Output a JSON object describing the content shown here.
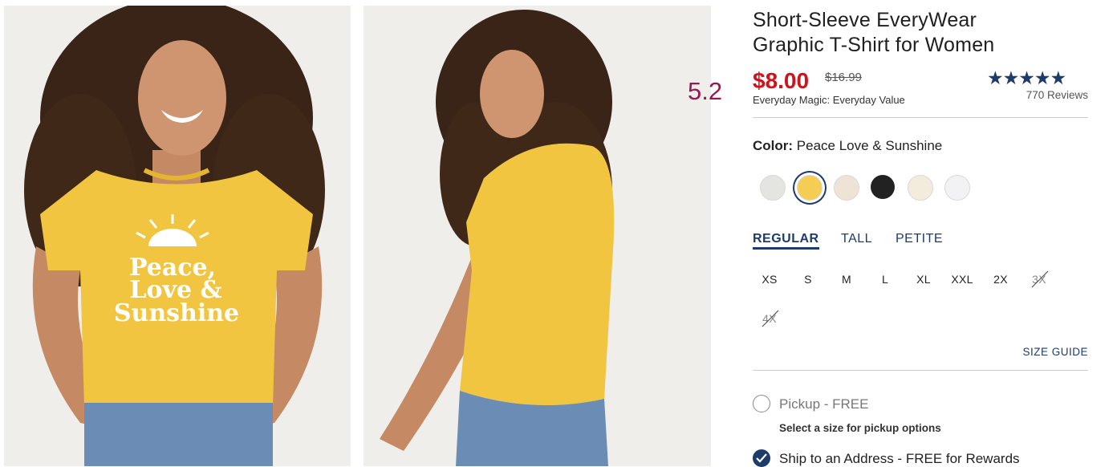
{
  "overlay_label": "5.2",
  "product": {
    "title_line1": "Short-Sleeve EveryWear",
    "title_line2": "Graphic T-Shirt for Women",
    "sale_price": "$8.00",
    "original_price": "$16.99",
    "value_note": "Everyday Magic: Everyday Value",
    "rating": 4.5,
    "stars_display": "★★★★★",
    "reviews": "770 Reviews",
    "shirt_graphic": [
      "Peace,",
      "Love &",
      "Sunshine"
    ]
  },
  "color": {
    "label": "Color:",
    "value": "Peace Love & Sunshine",
    "swatches": [
      {
        "name": "light-gray",
        "hex": "#e4e4e1",
        "selected": false
      },
      {
        "name": "yellow",
        "hex": "#f5cd55",
        "selected": true
      },
      {
        "name": "beige",
        "hex": "#efe3d5",
        "selected": false
      },
      {
        "name": "black",
        "hex": "#222222",
        "selected": false
      },
      {
        "name": "cream",
        "hex": "#f3ecdc",
        "selected": false
      },
      {
        "name": "white",
        "hex": "#f2f2f4",
        "selected": false
      }
    ]
  },
  "fit_tabs": [
    {
      "label": "REGULAR",
      "active": true
    },
    {
      "label": "TALL",
      "active": false
    },
    {
      "label": "PETITE",
      "active": false
    }
  ],
  "sizes": [
    {
      "label": "XS",
      "available": true
    },
    {
      "label": "S",
      "available": true
    },
    {
      "label": "M",
      "available": true
    },
    {
      "label": "L",
      "available": true
    },
    {
      "label": "XL",
      "available": true
    },
    {
      "label": "XXL",
      "available": true
    },
    {
      "label": "2X",
      "available": true
    },
    {
      "label": "3X",
      "available": false
    },
    {
      "label": "4X",
      "available": false
    }
  ],
  "size_guide": "SIZE GUIDE",
  "shipping": {
    "pickup_label": "Pickup - FREE",
    "pickup_note": "Select a size for pickup options",
    "ship_label": "Ship to an Address - FREE for Rewards"
  },
  "colors": {
    "accent": "#1d3b6b",
    "sale": "#d0121b",
    "overlay": "#a0154f"
  }
}
